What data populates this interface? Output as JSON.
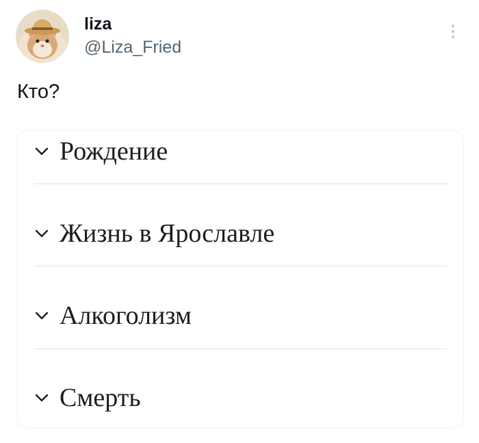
{
  "author": {
    "display_name": "liza",
    "handle": "@Liza_Fried",
    "avatar_icon": "hamster-with-hat-avatar"
  },
  "tweet": {
    "text": "Кто?"
  },
  "card": {
    "sections": [
      {
        "label": "Рождение",
        "icon": "chevron-down-icon"
      },
      {
        "label": "Жизнь в Ярославле",
        "icon": "chevron-down-icon"
      },
      {
        "label": "Алкоголизм",
        "icon": "chevron-down-icon"
      },
      {
        "label": "Смерть",
        "icon": "chevron-down-icon"
      }
    ]
  },
  "colors": {
    "text_primary": "#0f1419",
    "text_secondary": "#536471",
    "divider": "#e3e3e3"
  }
}
